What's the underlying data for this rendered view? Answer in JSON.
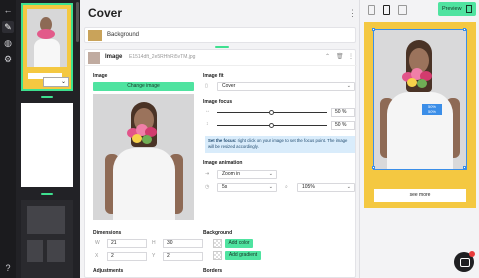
{
  "editor": {
    "title": "Cover",
    "background_label": "Background",
    "image_section": {
      "title": "Image",
      "filename": "E1514dft_2e5RHhRi5vTM.jpg",
      "image_label": "Image",
      "change_image": "Change image",
      "image_fit_label": "Image fit",
      "image_fit_value": "Cover",
      "image_focus_label": "Image focus",
      "focus_x": "50 %",
      "focus_y": "50 %",
      "focus_x_level": 0.5,
      "focus_y_level": 0.5,
      "info_bold": "Set the focus:",
      "info_text": " right click on your image to set the focus point. The image will be resized accordingly.",
      "image_animation_label": "Image animation",
      "animation_value": "Zoom in",
      "duration_value": "5s",
      "scale_value": "105%",
      "dimensions_label": "Dimensions",
      "dim_w": "21",
      "dim_h": "30",
      "dim_x": "2",
      "dim_y": "2",
      "background_label": "Background",
      "add_color": "Add color",
      "add_gradient": "Add gradient",
      "adjustments_label": "Adjustments",
      "borders_label": "Borders"
    }
  },
  "thumbs": {
    "select_caret": "⌄"
  },
  "preview": {
    "button_label": "Preview",
    "see_more": "see more",
    "focus_tag_line1": "50%",
    "focus_tag_line2": "50%"
  },
  "colors": {
    "accent": "#4fe3a0",
    "card_yellow": "#f4c841",
    "focus_blue": "#3b8ee8"
  }
}
